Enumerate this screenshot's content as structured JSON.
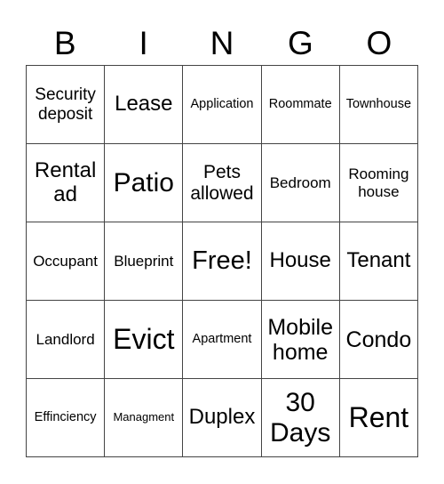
{
  "header": [
    "B",
    "I",
    "N",
    "G",
    "O"
  ],
  "cells": [
    {
      "text": "Security deposit",
      "size": "s19"
    },
    {
      "text": "Lease",
      "size": "s24"
    },
    {
      "text": "Application",
      "size": "s14"
    },
    {
      "text": "Roommate",
      "size": "s14"
    },
    {
      "text": "Townhouse",
      "size": "s14"
    },
    {
      "text": "Rental ad",
      "size": "s24"
    },
    {
      "text": "Patio",
      "size": "s30"
    },
    {
      "text": "Pets allowed",
      "size": "s21"
    },
    {
      "text": "Bedroom",
      "size": "s17"
    },
    {
      "text": "Rooming house",
      "size": "s17"
    },
    {
      "text": "Occupant",
      "size": "s17"
    },
    {
      "text": "Blueprint",
      "size": "s17"
    },
    {
      "text": "Free!",
      "size": "s29"
    },
    {
      "text": "House",
      "size": "s24"
    },
    {
      "text": "Tenant",
      "size": "s24"
    },
    {
      "text": "Landlord",
      "size": "s17"
    },
    {
      "text": "Evict",
      "size": "s32"
    },
    {
      "text": "Apartment",
      "size": "s14"
    },
    {
      "text": "Mobile home",
      "size": "s25"
    },
    {
      "text": "Condo",
      "size": "s25"
    },
    {
      "text": "Effinciency",
      "size": "s14"
    },
    {
      "text": "Managment",
      "size": "s13"
    },
    {
      "text": "Duplex",
      "size": "s24"
    },
    {
      "text": "30 Days",
      "size": "s30"
    },
    {
      "text": "Rent",
      "size": "s32"
    }
  ]
}
